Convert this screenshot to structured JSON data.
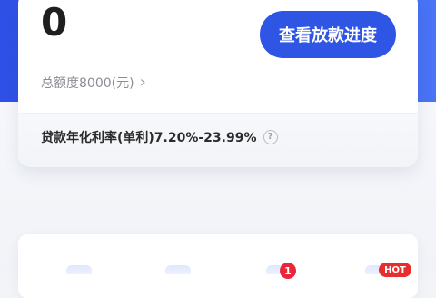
{
  "loan_card": {
    "available_amount": "0",
    "progress_button": "查看放款进度",
    "total_limit_label": "总额度8000(元)",
    "rate_label": "贷款年化利率(单利)7.20%-23.99%"
  },
  "quick_entries": {
    "badge_count": "1",
    "badge_hot": "HOT"
  },
  "icons": {
    "chevron": "chevron-right-icon",
    "help": "question-circle-icon"
  },
  "colors": {
    "brand_blue": "#2f55e5",
    "badge_red": "#e9263a"
  }
}
